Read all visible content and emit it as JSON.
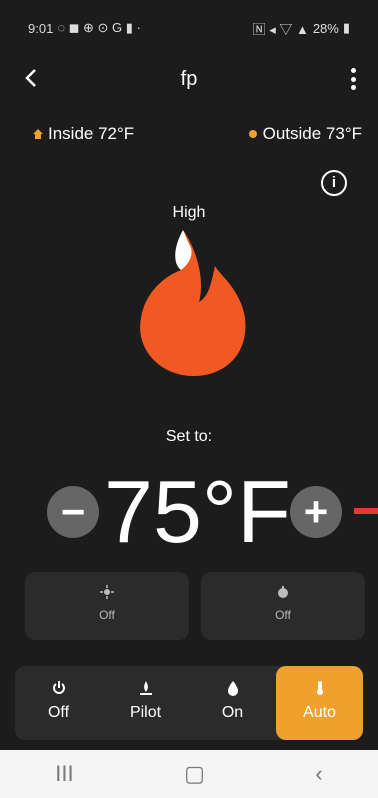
{
  "status": {
    "time": "9:01",
    "battery": "28%"
  },
  "header": {
    "title": "fp"
  },
  "temps": {
    "inside": "Inside 72°F",
    "outside": "Outside 73°F"
  },
  "flame": {
    "level_label": "High"
  },
  "setpoint": {
    "label": "Set to:",
    "value": "75°F"
  },
  "modes": [
    {
      "label": "Off"
    },
    {
      "label": "Off"
    }
  ],
  "controls": [
    {
      "label": "Off"
    },
    {
      "label": "Pilot"
    },
    {
      "label": "On"
    },
    {
      "label": "Auto"
    }
  ],
  "nav": {
    "recent": "III",
    "home": "▢",
    "back": "‹"
  },
  "icons": [
    "home-icon",
    "sun-icon",
    "info-icon",
    "flame-icon",
    "minus-icon",
    "plus-icon",
    "light-icon",
    "timer-icon",
    "power-icon",
    "pilot-icon",
    "drop-icon",
    "thermometer-icon"
  ],
  "colors": {
    "accent": "#f0a12d",
    "flame": "#f05a22",
    "background": "#1c1c1c"
  }
}
